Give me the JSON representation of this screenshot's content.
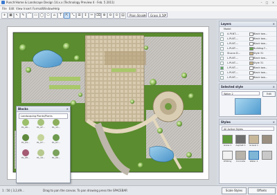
{
  "window": {
    "title": "Punch!Home & Landscape Design 14.x.x (Technology Preview 4 · Feb. 5 2011)",
    "controls": [
      "–",
      "□",
      "×"
    ]
  },
  "menu": [
    "File",
    "Edit",
    "View",
    "Insert",
    "Format",
    "Window",
    "Help"
  ],
  "toolbar": {
    "tools": [
      "+",
      "▣",
      "↖",
      "✎",
      "⌒",
      "▭",
      "◯",
      "⬠",
      "⌂",
      "T",
      "⇱",
      "⤡",
      "⊞",
      "↕",
      "✂",
      "⌫",
      "⊕",
      "⊖",
      "⊙",
      "▤"
    ],
    "combo1": "Plain Stroke",
    "combo2": "Grass 0.50\""
  },
  "layers": {
    "title": "Layers",
    "rows": [
      {
        "name": "Model",
        "style": "",
        "color": "#ffffff"
      },
      {
        "name": "A-PLNT-...",
        "style": "Black tow...",
        "color": "#ffffff"
      },
      {
        "name": "L-PLNT-...",
        "style": "Black tow...",
        "color": "#ffffff"
      },
      {
        "name": "L-PLNT-...",
        "style": "Black tow...",
        "color": "#ffffff"
      },
      {
        "name": "L-PLNT-...",
        "style": "Building F...",
        "color": "#6aa84f"
      },
      {
        "name": "Stucco D...",
        "style": "Style 31",
        "color": "#c9b48a"
      },
      {
        "name": "L-PLNT-...",
        "style": "Black tow...",
        "color": "#ffffff"
      },
      {
        "name": "L-PLNT-...",
        "style": "Style 31",
        "color": "#c9b48a"
      },
      {
        "name": "L-PLNT-...",
        "style": "Black tow...",
        "color": "#ffffff"
      },
      {
        "name": "L-PLNT-...",
        "style": "Black tow...",
        "color": "#ffffff"
      },
      {
        "name": "L-PLNT-...",
        "style": "Black tow...",
        "color": "#ffffff"
      }
    ]
  },
  "selected_style": {
    "title": "Selected style",
    "value": "Water 2",
    "edit_label": "Edit"
  },
  "styles": {
    "title": "Styles",
    "filter": "All Active Styles",
    "items": [
      {
        "label": "Grass 1",
        "color": "#5e9a3a"
      },
      {
        "label": "Asphalt 1",
        "color": "#6e6e6e"
      },
      {
        "label": "Gravel 1",
        "color": "#c8b89a"
      },
      {
        "label": "",
        "color": "#9a8f80"
      },
      {
        "label": "Whiting",
        "color": "#f1f1f1"
      },
      {
        "label": "Concrete",
        "color": "#b9b4ab"
      },
      {
        "label": "Water 2",
        "color": "#7fb6d6"
      },
      {
        "label": "",
        "color": "#c9c9c9"
      }
    ]
  },
  "blocks": {
    "title": "Blocks",
    "library": "Landscaping Plants/Plants",
    "items": [
      {
        "label": "PL_06...",
        "color": "#9bbf6a"
      },
      {
        "label": "PL_47...",
        "color": "#a6c27a"
      },
      {
        "label": "PL_13...",
        "color": "#8cae5c"
      },
      {
        "label": "PL_04...",
        "color": "#5f8a3e"
      },
      {
        "label": "PL_07...",
        "color": "#c5d49a"
      },
      {
        "label": "PL_07...",
        "color": "#6d9a4e"
      },
      {
        "label": "PL_08...",
        "color": "#a35a72"
      },
      {
        "label": "PL_14...",
        "color": "#b7c98e"
      },
      {
        "label": "PL_06...",
        "color": "#7ba25c"
      }
    ]
  },
  "status": {
    "left": "Drag to pan the canvas. To pan drawing press the SPACEBAR",
    "coords": "1 : 50 | 3,2,49...",
    "btn1": "Scale Styles",
    "btn2": "Offsets"
  }
}
